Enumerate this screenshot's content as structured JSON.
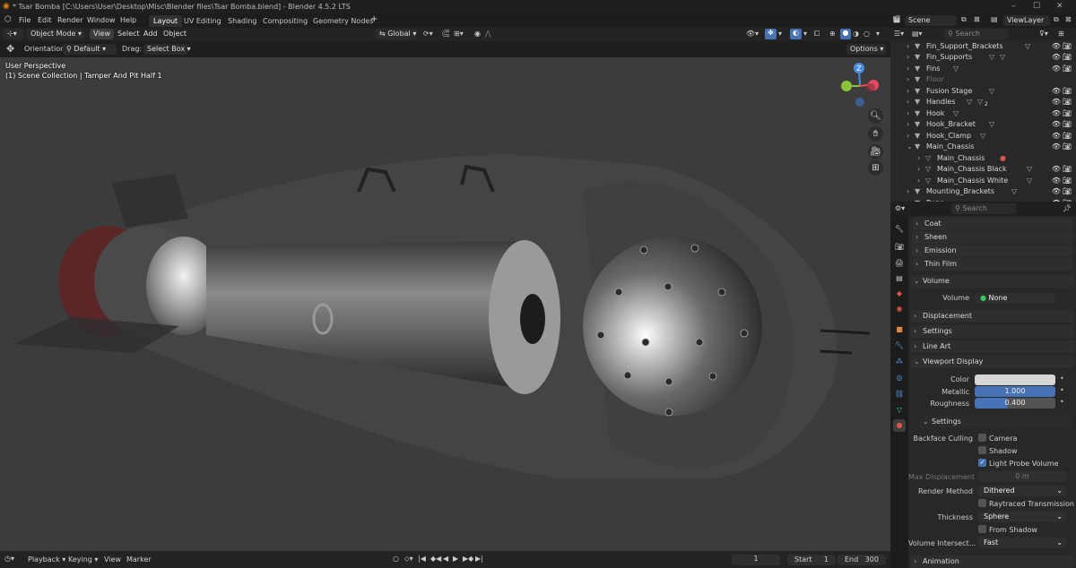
{
  "window": {
    "title": "* Tsar Bomba [C:\\Users\\User\\Desktop\\Misc\\Blender files\\Tsar Bomba.blend] - Blender 4.5.2 LTS",
    "controls": [
      "–",
      "☐",
      "✕"
    ]
  },
  "menu": {
    "items": [
      "File",
      "Edit",
      "Render",
      "Window",
      "Help"
    ],
    "workspaces": [
      "Layout",
      "UV Editing",
      "Shading",
      "Compositing",
      "Geometry Nodes"
    ],
    "active_workspace": "Layout",
    "add_workspace": "+"
  },
  "topright": {
    "scene": "Scene",
    "view_layer": "ViewLayer"
  },
  "header3d": {
    "mode": "Object Mode",
    "menus": [
      "View",
      "Select",
      "Add",
      "Object"
    ],
    "transform_orientation": "Global"
  },
  "tooltool": {
    "orientation_label": "Orientation:",
    "orientation_value": "Default",
    "drag_label": "Drag:",
    "drag_value": "Select Box",
    "options": "Options"
  },
  "viewport": {
    "perspective": "User Perspective",
    "collection": "(1) Scene Collection | Tamper And Pit Half 1",
    "gizmo_axis": "Z"
  },
  "timeline": {
    "menus": [
      "Playback",
      "Keying",
      "View",
      "Marker"
    ],
    "current_frame": "1",
    "start_label": "Start",
    "start": "1",
    "end_label": "End",
    "end": "300"
  },
  "outliner": {
    "search_placeholder": "Search",
    "items": [
      {
        "name": "Fin_Support_Brackets",
        "dim": false
      },
      {
        "name": "Fin_Supports",
        "dim": false
      },
      {
        "name": "Fins",
        "dim": false
      },
      {
        "name": "Floor",
        "dim": true
      },
      {
        "name": "Fusion Stage",
        "dim": false
      },
      {
        "name": "Handles",
        "dim": false,
        "badge": "2"
      },
      {
        "name": "Hook",
        "dim": false
      },
      {
        "name": "Hook_Bracket",
        "dim": false
      },
      {
        "name": "Hook_Clamp",
        "dim": false
      },
      {
        "name": "Main_Chassis",
        "dim": false
      },
      {
        "name": "Main_Chassis",
        "dim": false
      },
      {
        "name": "Main_Chassis Black",
        "dim": false
      },
      {
        "name": "Main_Chassis White",
        "dim": false
      },
      {
        "name": "Mounting_Brackets",
        "dim": false
      },
      {
        "name": "Rope",
        "dim": false
      }
    ]
  },
  "properties": {
    "search_placeholder": "Search",
    "sections": {
      "coat": "Coat",
      "sheen": "Sheen",
      "emission": "Emission",
      "thin_film": "Thin Film",
      "volume": "Volume",
      "displacement": "Displacement",
      "settings": "Settings",
      "line_art": "Line Art",
      "viewport_display": "Viewport Display",
      "vd_settings": "Settings",
      "animation": "Animation"
    },
    "volume_label": "Volume",
    "volume_value": "None",
    "color_label": "Color",
    "color_swatch": "#d6d6d6",
    "metallic_label": "Metallic",
    "metallic_value": "1.000",
    "roughness_label": "Roughness",
    "roughness_value": "0.400",
    "backface_label": "Backface Culling",
    "camera_label": "Camera",
    "shadow_label": "Shadow",
    "light_probe_label": "Light Probe Volume",
    "max_disp_label": "Max Displacement",
    "max_disp_value": "0 m",
    "render_method_label": "Render Method",
    "render_method_value": "Dithered",
    "raytraced_label": "Raytraced Transmission",
    "thickness_label": "Thickness",
    "thickness_value": "Sphere",
    "from_shadow_label": "From Shadow",
    "vol_intersect_label": "Volume Intersect...",
    "vol_intersect_value": "Fast"
  },
  "colors": {
    "accent": "#4772b3",
    "object_icon": "#e08840",
    "mesh_icon": "#3cc9a8",
    "viewport_bg": "#3c3c3c"
  }
}
